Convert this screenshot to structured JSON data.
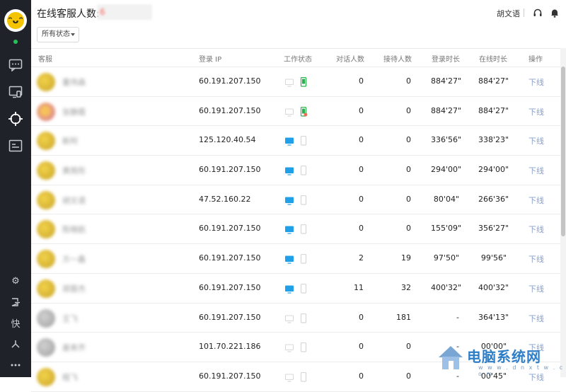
{
  "header": {
    "title": "在线客服人数:",
    "filter_label": "所有状态",
    "user_name": "胡文语",
    "icons": [
      "headset-icon",
      "bell-icon"
    ]
  },
  "sidebar": {
    "logo_icon": "smiley-logo-icon",
    "items": [
      "chat-icon",
      "monitor-icon",
      "target-icon",
      "card-icon"
    ],
    "bottom_items": [
      "gear-icon",
      "exit-icon",
      "shortcut-icon",
      "branch-icon",
      "more-icon"
    ],
    "shortcut_label": "快"
  },
  "table": {
    "columns": [
      "客服",
      "登录 IP",
      "工作状态",
      "对话人数",
      "接待人数",
      "登录时长",
      "在线时长",
      "操作"
    ],
    "rows": [
      {
        "name": "董伟森",
        "avatar": "yellow",
        "ip": "60.191.207.150",
        "pc": "off",
        "mobile": "green",
        "chats": "0",
        "served": "0",
        "login": "884'27\"",
        "online": "884'27\"",
        "action": "下线"
      },
      {
        "name": "张静霞",
        "avatar": "ring",
        "ip": "60.191.207.150",
        "pc": "off",
        "mobile": "green-alert",
        "chats": "0",
        "served": "0",
        "login": "884'27\"",
        "online": "884'27\"",
        "action": "下线"
      },
      {
        "name": "新阿",
        "avatar": "yellow",
        "ip": "125.120.40.54",
        "pc": "blue",
        "mobile": "off",
        "chats": "0",
        "served": "0",
        "login": "336'56\"",
        "online": "338'23\"",
        "action": "下线"
      },
      {
        "name": "黄雨彤",
        "avatar": "yellow",
        "ip": "60.191.207.150",
        "pc": "blue",
        "mobile": "off",
        "chats": "0",
        "served": "0",
        "login": "294'00\"",
        "online": "294'00\"",
        "action": "下线"
      },
      {
        "name": "胡文语",
        "avatar": "yellow",
        "ip": "47.52.160.22",
        "pc": "blue",
        "mobile": "off",
        "chats": "0",
        "served": "0",
        "login": "80'04\"",
        "online": "266'36\"",
        "action": "下线"
      },
      {
        "name": "陈晓航",
        "avatar": "yellow",
        "ip": "60.191.207.150",
        "pc": "blue",
        "mobile": "off",
        "chats": "0",
        "served": "0",
        "login": "155'09\"",
        "online": "356'27\"",
        "action": "下线"
      },
      {
        "name": "方一鑫",
        "avatar": "yellow",
        "ip": "60.191.207.150",
        "pc": "blue",
        "mobile": "off",
        "chats": "2",
        "served": "19",
        "login": "97'50\"",
        "online": "99'56\"",
        "action": "下线"
      },
      {
        "name": "郑蓉杰",
        "avatar": "yellow",
        "ip": "60.191.207.150",
        "pc": "blue",
        "mobile": "off",
        "chats": "11",
        "served": "32",
        "login": "400'32\"",
        "online": "400'32\"",
        "action": "下线"
      },
      {
        "name": "王飞",
        "avatar": "grey",
        "ip": "60.191.207.150",
        "pc": "off",
        "mobile": "off",
        "chats": "0",
        "served": "181",
        "login": "-",
        "online": "364'13\"",
        "action": "下线"
      },
      {
        "name": "姜来齐",
        "avatar": "grey",
        "ip": "101.70.221.186",
        "pc": "off",
        "mobile": "off",
        "chats": "0",
        "served": "0",
        "login": "-",
        "online": "00'00\"",
        "action": "下线"
      },
      {
        "name": "程飞",
        "avatar": "yellow",
        "ip": "60.191.207.150",
        "pc": "off",
        "mobile": "off",
        "chats": "0",
        "served": "0",
        "login": "-",
        "online": "00'45\"",
        "action": "下线"
      }
    ]
  },
  "colors": {
    "sidebar_bg": "#1f2329",
    "accent_blue": "#1fa0e8",
    "mobile_green": "#27b04b",
    "link": "#8aa0c8",
    "online_dot": "#25c25a"
  },
  "watermark": {
    "text": "电脑系统网",
    "sub": "w w w . d n x t w . c o m"
  }
}
